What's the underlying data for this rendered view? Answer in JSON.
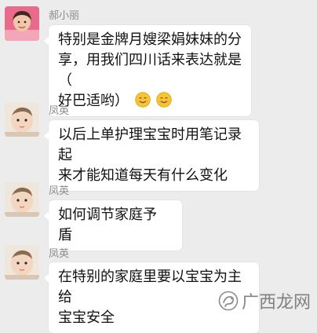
{
  "messages": [
    {
      "sender": "郝小丽",
      "avatar_icon": "woman-photo-avatar",
      "lines": [
        "特别是金牌月嫂梁娟妹妹的分",
        "享，用我们四川话来表达就是（",
        "好巴适哟）"
      ],
      "emoji_count": 2,
      "emoji_icon": "smiling-face-icon"
    },
    {
      "sender": "凤英",
      "avatar_icon": "baby-photo-avatar",
      "lines": [
        "以后上单护理宝宝时用笔记录起",
        "来才能知道每天有什么变化"
      ]
    },
    {
      "sender": "凤英",
      "avatar_icon": "baby-photo-avatar",
      "lines": [
        "如何调节家庭予 盾"
      ]
    },
    {
      "sender": "凤英",
      "avatar_icon": "baby-photo-avatar",
      "lines": [
        "在特别的家庭里要以宝宝为主给",
        "宝宝安全"
      ]
    }
  ],
  "watermark": {
    "text": "广西龙网",
    "icon": "guangxi-longwang-logo"
  },
  "colors": {
    "background": "#ececec",
    "bubble": "#ffffff",
    "sender_name": "#8a8a8a",
    "emoji_yellow": "#f7c531"
  }
}
